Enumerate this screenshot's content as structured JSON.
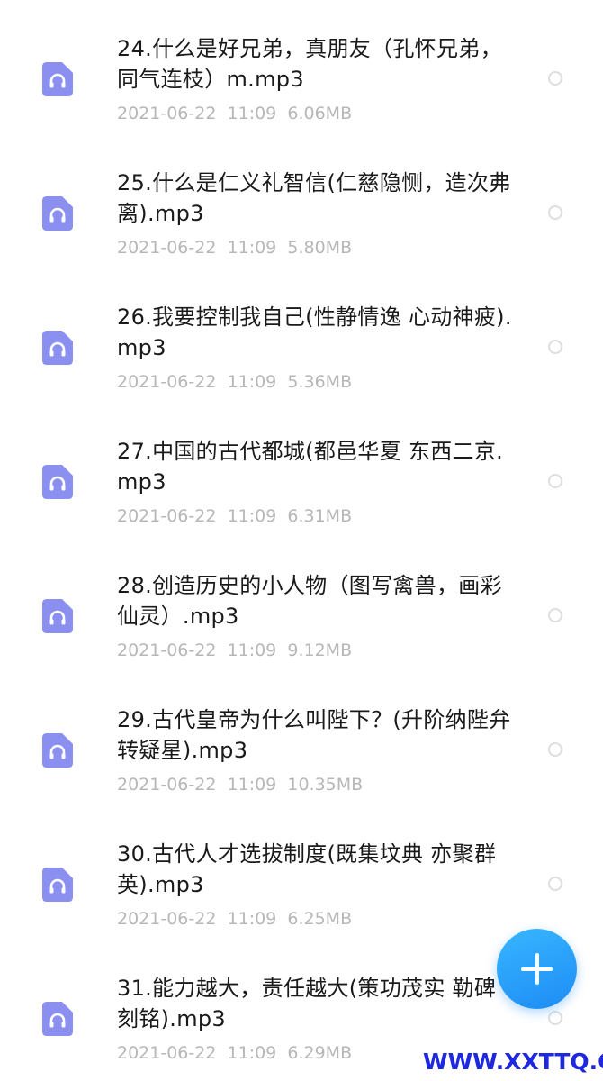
{
  "files": [
    {
      "name": "24.什么是好兄弟，真朋友（孔怀兄弟，同气连枝）m.mp3",
      "date": "2021-06-22",
      "time": "11:09",
      "size": "6.06MB"
    },
    {
      "name": "25.什么是仁义礼智信(仁慈隐恻，造次弗离).mp3",
      "date": "2021-06-22",
      "time": "11:09",
      "size": "5.80MB"
    },
    {
      "name": "26.我要控制我自己(性静情逸 心动神疲).mp3",
      "date": "2021-06-22",
      "time": "11:09",
      "size": "5.36MB"
    },
    {
      "name": "27.中国的古代都城(都邑华夏 东西二京.mp3",
      "date": "2021-06-22",
      "time": "11:09",
      "size": "6.31MB"
    },
    {
      "name": "28.创造历史的小人物（图写禽兽，画彩仙灵）.mp3",
      "date": "2021-06-22",
      "time": "11:09",
      "size": "9.12MB"
    },
    {
      "name": "29.古代皇帝为什么叫陛下？(升阶纳陛弁转疑星).mp3",
      "date": "2021-06-22",
      "time": "11:09",
      "size": "10.35MB"
    },
    {
      "name": "30.古代人才选拔制度(既集坟典 亦聚群英).mp3",
      "date": "2021-06-22",
      "time": "11:09",
      "size": "6.25MB"
    },
    {
      "name": "31.能力越大，责任越大(策功茂实 勒碑刻铭).mp3",
      "date": "2021-06-22",
      "time": "11:09",
      "size": "6.29MB"
    }
  ],
  "icons": {
    "file_icon": "audio-file-icon",
    "file_icon_color": "#8b8ff0",
    "fab_icon": "plus-icon",
    "fab_color": "#2a9ff9"
  },
  "watermark": "WWW.XXTTQ.COM"
}
